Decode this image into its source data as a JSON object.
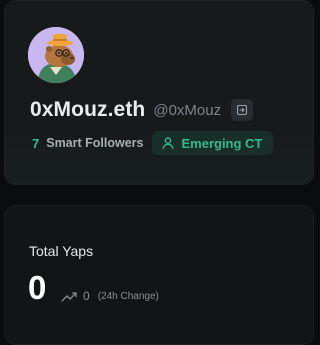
{
  "profile": {
    "display_name": "0xMouz.eth",
    "handle": "@0xMouz",
    "avatar_icon": "capybara-avatar",
    "logout_icon": "logout-icon",
    "smart_followers": {
      "count": "7",
      "label": "Smart Followers"
    },
    "badge": {
      "icon": "user-icon",
      "label": "Emerging CT"
    }
  },
  "yaps": {
    "title": "Total Yaps",
    "value": "0",
    "change_icon": "trending-up-icon",
    "change_value": "0",
    "change_label": "(24h Change)"
  },
  "colors": {
    "background": "#0b0c0d",
    "card": "#17191b",
    "accent": "#3ad8a8",
    "badge_bg": "#173129",
    "muted_text": "#7f8489"
  }
}
